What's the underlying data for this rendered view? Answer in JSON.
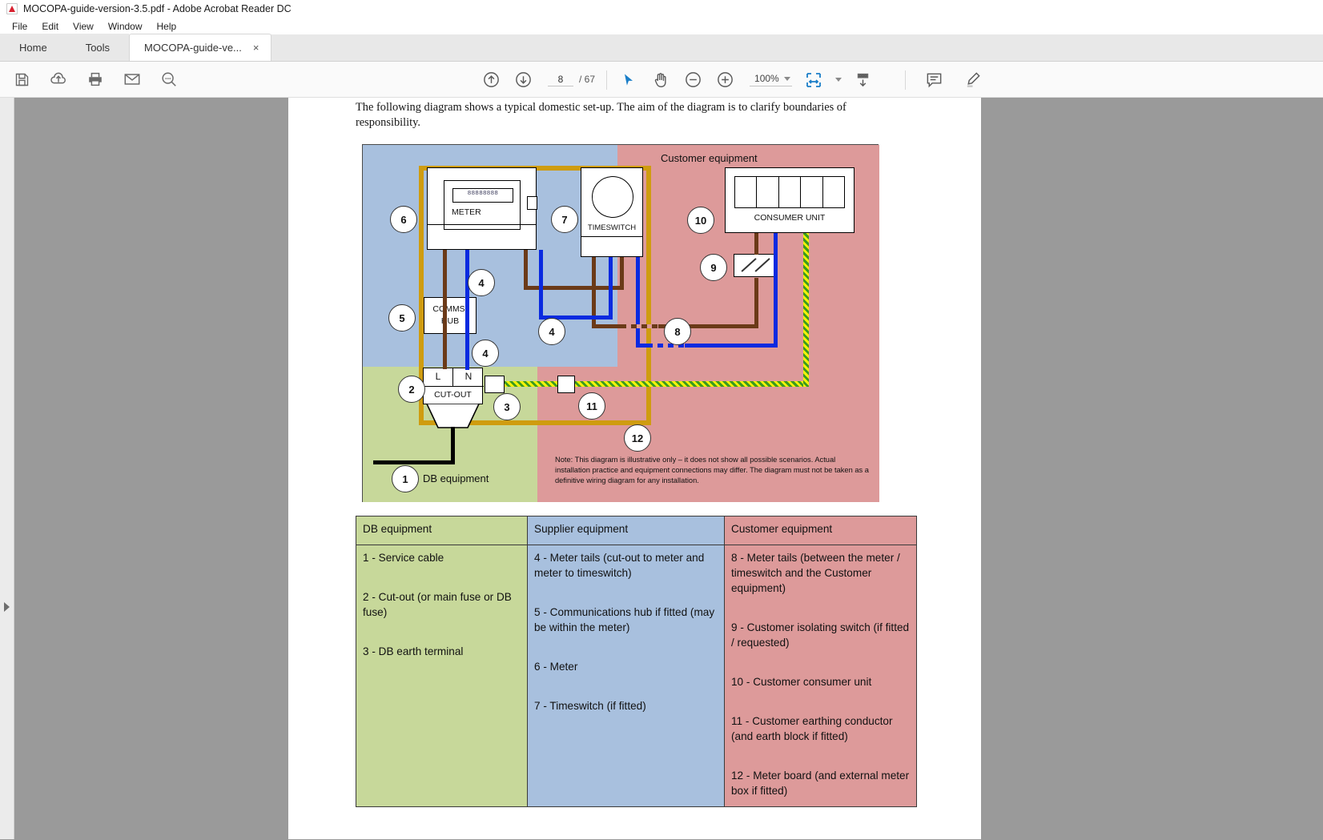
{
  "window": {
    "title": "MOCOPA-guide-version-3.5.pdf - Adobe Acrobat Reader DC",
    "app_icon": "acrobat-logo-icon"
  },
  "menu": {
    "items": [
      "File",
      "Edit",
      "View",
      "Window",
      "Help"
    ]
  },
  "tabs": {
    "home": "Home",
    "tools": "Tools",
    "document": "MOCOPA-guide-ve...",
    "close_glyph": "×"
  },
  "toolbar": {
    "left_icons": [
      "save-icon",
      "upload-cloud-icon",
      "print-icon",
      "email-icon",
      "search-zoom-icon"
    ],
    "page_current": "8",
    "page_total": "/ 67",
    "nav_icons": [
      "previous-page-icon",
      "next-page-icon"
    ],
    "tools": [
      "select-cursor-icon",
      "hand-pan-icon",
      "zoom-out-icon",
      "zoom-in-icon"
    ],
    "zoom_level": "100%",
    "fit_icon": "fit-page-icon",
    "scroll_icon": "scroll-mode-icon",
    "right_icons": [
      "comment-icon",
      "highlight-pen-icon"
    ],
    "accent_color": "#1a7ec8"
  },
  "document": {
    "intro": "The following diagram shows a typical domestic set-up.  The aim of the diagram is to clarify boundaries of responsibility."
  },
  "diagram": {
    "zone_labels": {
      "customer": "Customer equipment",
      "db": "DB equipment"
    },
    "components": {
      "meter": "METER",
      "meter_digits": "88888888",
      "timeswitch": "TIMESWITCH",
      "consumer_unit": "CONSUMER UNIT",
      "comms_hub_line1": "COMMS.",
      "comms_hub_line2": "HUB",
      "cutout": "CUT-OUT",
      "cutout_l": "L",
      "cutout_n": "N"
    },
    "markers": [
      "1",
      "2",
      "3",
      "4",
      "4",
      "4",
      "5",
      "6",
      "7",
      "8",
      "9",
      "10",
      "11",
      "12"
    ],
    "note": "Note: This diagram is illustrative only – it does not show all possible scenarios.  Actual installation practice and equipment connections may differ.  The diagram must not be taken as a definitive wiring diagram for any installation.",
    "colors": {
      "supplier_zone": "#a8c0de",
      "db_zone": "#c7d89a",
      "customer_zone": "#dd9a9a",
      "live_wire": "#6b3a18",
      "neutral_wire": "#0a2ae0",
      "service_cable": "#000000",
      "meter_board": "#cf9c10",
      "earth_wire": "#f2f20a"
    }
  },
  "legend": {
    "headers": [
      "DB equipment",
      "Supplier equipment",
      "Customer equipment"
    ],
    "db": [
      "1 - Service cable",
      "2 - Cut-out (or main fuse or DB fuse)",
      "3 - DB earth terminal"
    ],
    "supplier": [
      "4 - Meter tails (cut-out to meter and meter to timeswitch)",
      "5 - Communications hub if fitted (may be within the meter)",
      "6 - Meter",
      "7 - Timeswitch (if fitted)"
    ],
    "customer": [
      "8 - Meter tails (between the meter / timeswitch and the Customer equipment)",
      "9 - Customer isolating switch (if fitted / requested)",
      "10 - Customer consumer unit",
      "11 - Customer earthing conductor (and earth block if fitted)",
      "12 - Meter board (and external meter box if fitted)"
    ]
  }
}
